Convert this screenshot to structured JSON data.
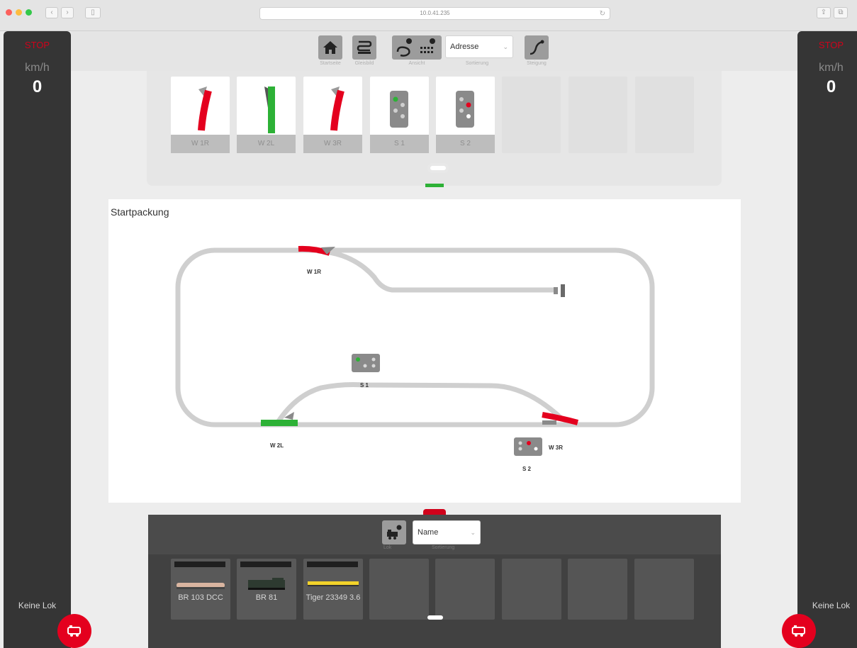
{
  "browser": {
    "url": "10.0.41.235",
    "window_buttons": [
      "close",
      "minimize",
      "zoom"
    ],
    "nav": {
      "back": "‹",
      "forward": "›"
    }
  },
  "left_panel": {
    "stop": "STOP",
    "unit": "km/h",
    "speed": "0",
    "lok": "Keine Lok"
  },
  "right_panel": {
    "stop": "STOP",
    "unit": "km/h",
    "speed": "0",
    "lok": "Keine Lok"
  },
  "toolbar": {
    "items": [
      {
        "label": "Startseite",
        "icon": "home-icon"
      },
      {
        "label": "Gleisbild",
        "icon": "track-layout-icon"
      },
      {
        "label": "Ansicht",
        "icon": "keyboard-view-icon"
      },
      {
        "label": "Steigung",
        "icon": "curve-icon"
      }
    ],
    "select": {
      "value": "Adresse",
      "caption": "Sortierung"
    }
  },
  "keyboard": {
    "tiles": [
      {
        "label": "W 1R",
        "type": "turnout-right",
        "state": "red"
      },
      {
        "label": "W 2L",
        "type": "turnout-left",
        "state": "green"
      },
      {
        "label": "W 3R",
        "type": "turnout-right",
        "state": "red"
      },
      {
        "label": "S 1",
        "type": "signal",
        "state": "green"
      },
      {
        "label": "S 2",
        "type": "signal",
        "state": "red"
      }
    ],
    "empty_tiles": 3
  },
  "track": {
    "title": "Startpackung",
    "labels": {
      "w1r": "W 1R",
      "w2l": "W 2L",
      "w3r": "W 3R",
      "s1": "S 1",
      "s2": "S 2"
    }
  },
  "lok": {
    "select": {
      "value": "Name",
      "caption": "Sortierung"
    },
    "icon_label": "Lok",
    "tiles": [
      {
        "name": "BR 103 DCC"
      },
      {
        "name": "BR 81"
      },
      {
        "name": "Tiger 23349 3.6"
      }
    ],
    "empty_tiles": 5
  },
  "colors": {
    "accent": "#d0021b",
    "green": "#2db136",
    "track": "#cdcdcd",
    "dark": "#353535"
  }
}
